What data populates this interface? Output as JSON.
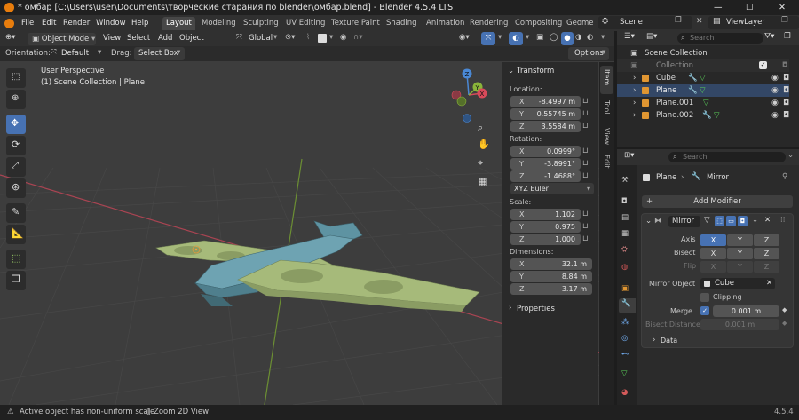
{
  "window": {
    "title": "* омбар [C:\\Users\\user\\Documents\\творческие старания по blender\\омбар.blend] - Blender 4.5.4 LTS",
    "minimize": "—",
    "maximize": "☐",
    "close": "✕"
  },
  "menubar": {
    "items": [
      "File",
      "Edit",
      "Render",
      "Window",
      "Help"
    ],
    "workspaces": [
      "Layout",
      "Modeling",
      "Sculpting",
      "UV Editing",
      "Texture Paint",
      "Shading",
      "Animation",
      "Rendering",
      "Compositing",
      "Geome"
    ],
    "active_workspace": "Layout",
    "scene": "Scene",
    "view_layer": "ViewLayer"
  },
  "viewport_header": {
    "mode": "Object Mode",
    "menus": [
      "View",
      "Select",
      "Add",
      "Object"
    ],
    "transform_orientation": "Global"
  },
  "tool_settings": {
    "orientation_label": "Orientation:",
    "orientation_value": "Default",
    "drag_label": "Drag:",
    "drag_value": "Select Box",
    "options": "Options"
  },
  "viewport": {
    "perspective": "User Perspective",
    "collection_info": "(1) Scene Collection | Plane",
    "gizmo_axes": [
      "Z",
      "Y",
      "X"
    ]
  },
  "n_panel": {
    "tabs": [
      "Item",
      "Tool",
      "View",
      "Edit"
    ],
    "transform_title": "Transform",
    "location_label": "Location:",
    "location": [
      {
        "axis": "X",
        "value": "-8.4997 m"
      },
      {
        "axis": "Y",
        "value": "0.55745 m"
      },
      {
        "axis": "Z",
        "value": "3.5584 m"
      }
    ],
    "rotation_label": "Rotation:",
    "rotation": [
      {
        "axis": "X",
        "value": "0.0999°"
      },
      {
        "axis": "Y",
        "value": "-3.8991°"
      },
      {
        "axis": "Z",
        "value": "-1.4688°"
      }
    ],
    "rotation_mode": "XYZ Euler",
    "scale_label": "Scale:",
    "scale": [
      {
        "axis": "X",
        "value": "1.102"
      },
      {
        "axis": "Y",
        "value": "0.975"
      },
      {
        "axis": "Z",
        "value": "1.000"
      }
    ],
    "dimensions_label": "Dimensions:",
    "dimensions": [
      {
        "axis": "X",
        "value": "32.1 m"
      },
      {
        "axis": "Y",
        "value": "8.84 m"
      },
      {
        "axis": "Z",
        "value": "3.17 m"
      }
    ],
    "properties_label": "Properties"
  },
  "outliner": {
    "search_placeholder": "Search",
    "rows": [
      {
        "name": "Scene Collection"
      },
      {
        "name": "Collection"
      },
      {
        "name": "Cube"
      },
      {
        "name": "Plane"
      },
      {
        "name": "Plane.001"
      },
      {
        "name": "Plane.002"
      }
    ]
  },
  "properties": {
    "search_placeholder": "Search",
    "object_name": "Plane",
    "modifier_path": "Mirror",
    "add_modifier": "Add Modifier",
    "modifier_name": "Mirror",
    "axis_label": "Axis",
    "bisect_label": "Bisect",
    "flip_label": "Flip",
    "axis_buttons": [
      "X",
      "Y",
      "Z"
    ],
    "axis_state": [
      "on",
      "off",
      "off"
    ],
    "mirror_object_label": "Mirror Object",
    "mirror_object": "Cube",
    "clipping_label": "Clipping",
    "merge_label": "Merge",
    "merge_value": "0.001 m",
    "bisect_distance_label": "Bisect Distance",
    "bisect_distance_value": "0.001 m",
    "data_label": "Data"
  },
  "statusbar": {
    "left": "Active object has non-uniform scale",
    "middle": "Zoom 2D View",
    "version": "4.5.4"
  },
  "colors": {
    "accent": "#4772b3",
    "x_axis": "#d84a5a",
    "y_axis": "#8ab43a",
    "z_axis": "#4a88d4",
    "wing": "#a6ba7a",
    "fuselage": "#5e93a2"
  }
}
